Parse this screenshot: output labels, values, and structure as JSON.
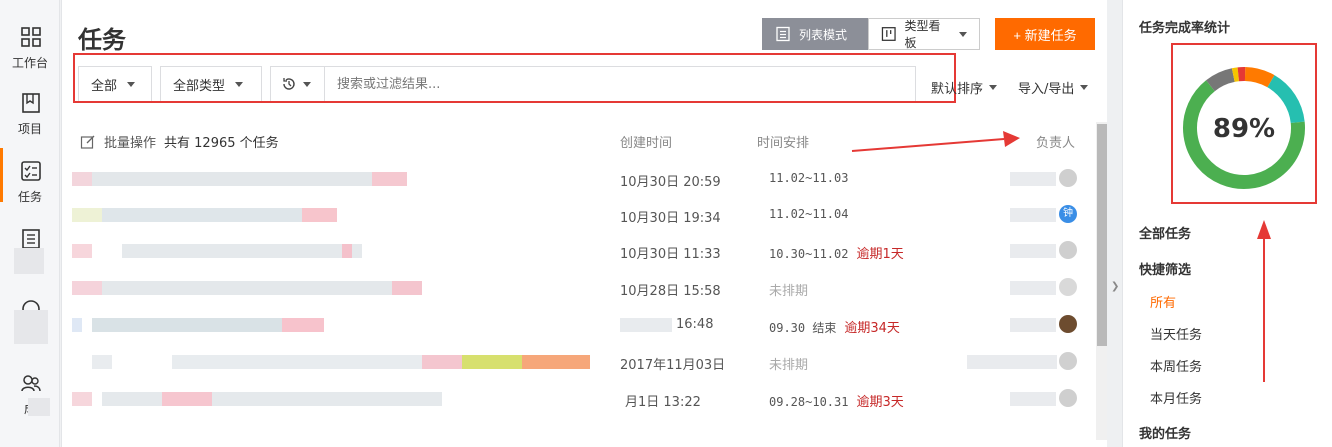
{
  "leftnav": {
    "items": [
      {
        "label": "工作台",
        "icon": "dashboard-icon"
      },
      {
        "label": "项目",
        "icon": "book-icon"
      },
      {
        "label": "任务",
        "icon": "checklist-icon"
      },
      {
        "label": "",
        "icon": "list-icon"
      },
      {
        "label": "",
        "icon": "clock-icon"
      },
      {
        "label": "成",
        "icon": "people-icon"
      }
    ]
  },
  "header": {
    "title": "任务",
    "list_mode": "列表模式",
    "board_mode": "类型看板",
    "new_task": "+ 新建任务"
  },
  "filters": {
    "scope": "全部",
    "type": "全部类型",
    "search_placeholder": "搜索或过滤结果...",
    "sort": "默认排序",
    "import_export": "导入/导出"
  },
  "table": {
    "batch_label": "批量操作",
    "total_label": "共有 12965 个任务",
    "col_created": "创建时间",
    "col_schedule": "时间安排",
    "col_owner": "负责人",
    "rows": [
      {
        "created": "10月30日 20:59",
        "schedule": "11.02~11.03",
        "overdue": ""
      },
      {
        "created": "10月30日 19:34",
        "schedule": "11.02~11.04",
        "overdue": "",
        "avatar_text": "钟"
      },
      {
        "created": "10月30日 11:33",
        "schedule": "10.30~11.02",
        "overdue": "逾期1天"
      },
      {
        "created": "10月28日 15:58",
        "schedule": "未排期",
        "overdue": ""
      },
      {
        "created": "16:48",
        "schedule": "09.30 结束",
        "overdue": "逾期34天"
      },
      {
        "created": "2017年11月03日",
        "schedule": "未排期",
        "overdue": ""
      },
      {
        "created": "月1日 13:22",
        "schedule": "09.28~10.31",
        "overdue": "逾期3天"
      }
    ]
  },
  "right_panel": {
    "title": "任务完成率统计",
    "percent": "89%",
    "completion": 0.89,
    "all_tasks": "全部任务",
    "quick_filter": "快捷筛选",
    "filters": [
      "所有",
      "当天任务",
      "本周任务",
      "本月任务"
    ],
    "my_tasks": "我的任务"
  },
  "chart_data": {
    "type": "pie",
    "title": "任务完成率统计",
    "center_label": "89%",
    "slices": [
      {
        "value": 66,
        "color": "#4caf50"
      },
      {
        "value": 15,
        "color": "#26bfb0"
      },
      {
        "value": 8,
        "color": "#ff7a00"
      },
      {
        "value": 2,
        "color": "#e53935"
      },
      {
        "value": 1.5,
        "color": "#f5c400"
      },
      {
        "value": 7.5,
        "color": "#777777"
      }
    ]
  },
  "colors": {
    "accent": "#ff6a00",
    "annotation": "#e53935",
    "complete": "#4caf50"
  }
}
